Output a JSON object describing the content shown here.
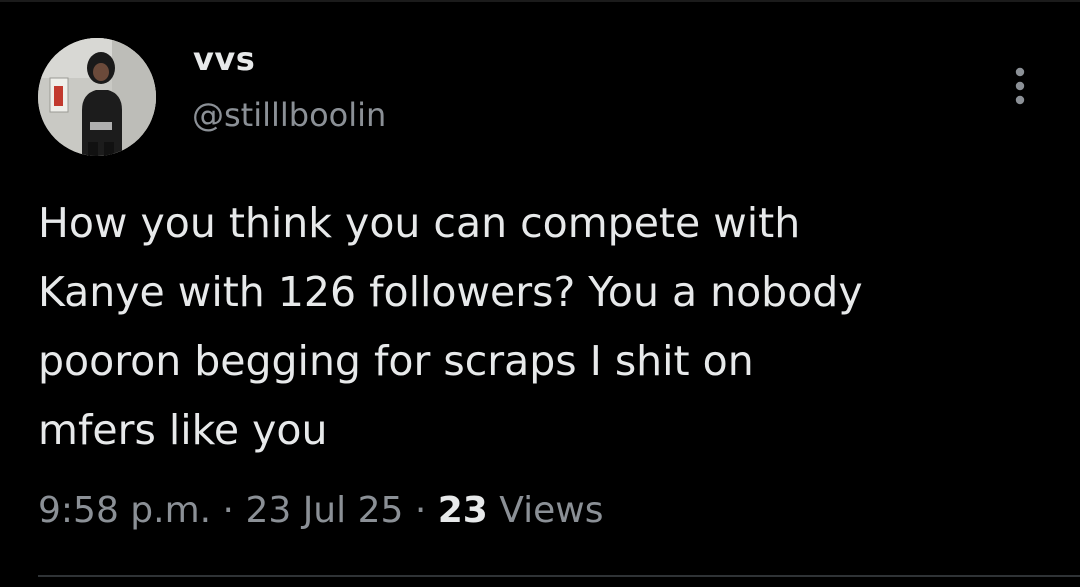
{
  "author": {
    "display_name": "vvs",
    "handle": "@stilllboolin"
  },
  "post": {
    "text": "How you think you can compete with\nKanye with 126 followers? You a nobody\npooron begging for scraps I shit on\nmfers like you",
    "time": "9:58 p.m.",
    "separator": " · ",
    "date": "23 Jul 25",
    "views_count": "23",
    "views_label": "Views"
  },
  "icons": {
    "more": "more-vertical-icon",
    "avatar": "avatar-photo"
  },
  "colors": {
    "background": "#000000",
    "primary_text": "#e7e9ea",
    "secondary_text": "#8b9096",
    "divider": "#2f3336"
  }
}
